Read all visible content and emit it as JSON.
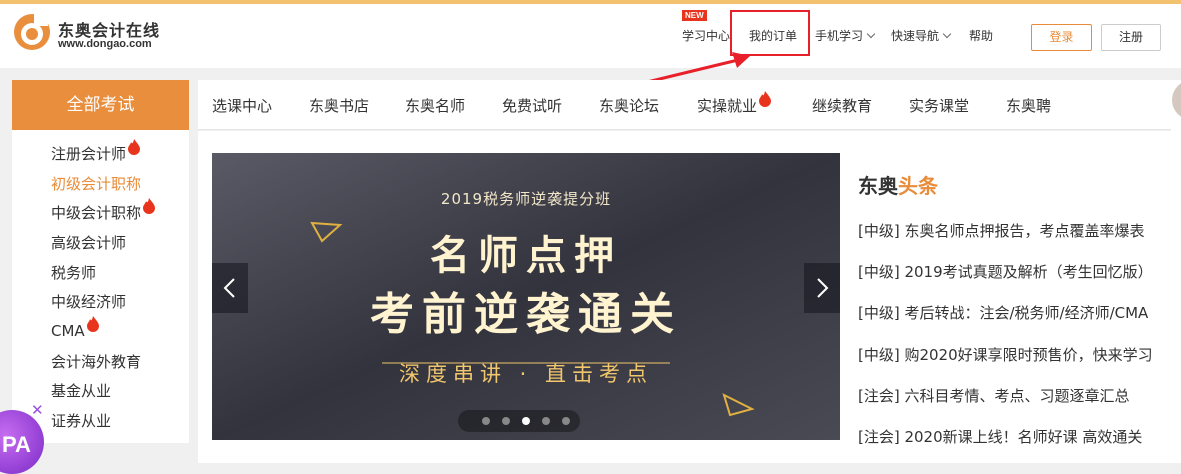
{
  "brand": {
    "name": "东奥会计在线",
    "url": "www.dongao.com"
  },
  "topnav": {
    "items": [
      {
        "label": "学习中心",
        "badge": "NEW"
      },
      {
        "label": "我的订单"
      },
      {
        "label": "手机学习",
        "has_dropdown": true
      },
      {
        "label": "快速导航",
        "has_dropdown": true
      },
      {
        "label": "帮助"
      }
    ],
    "login": "登录",
    "register": "注册"
  },
  "sidebar": {
    "header": "全部考试",
    "items": [
      {
        "label": "注册会计师",
        "hot": true
      },
      {
        "label": "初级会计职称",
        "active": true
      },
      {
        "label": "中级会计职称",
        "hot": true
      },
      {
        "label": "高级会计师"
      },
      {
        "label": "税务师"
      },
      {
        "label": "中级经济师"
      },
      {
        "label": "CMA",
        "hot": true
      },
      {
        "label": "会计海外教育"
      },
      {
        "label": "基金从业"
      },
      {
        "label": "证券从业"
      }
    ]
  },
  "mainnav": {
    "items": [
      {
        "label": "选课中心"
      },
      {
        "label": "东奥书店"
      },
      {
        "label": "东奥名师"
      },
      {
        "label": "免费试听"
      },
      {
        "label": "东奥论坛"
      },
      {
        "label": "实操就业",
        "hot": true
      },
      {
        "label": "继续教育"
      },
      {
        "label": "实务课堂"
      },
      {
        "label": "东奥聘"
      }
    ]
  },
  "banner": {
    "subtitle": "2019税务师逆袭提分班",
    "line1": "名师点押",
    "line2": "考前逆袭通关",
    "line3": "深度串讲 · 直击考点",
    "slide_count": 5,
    "active_slide": 3
  },
  "news": {
    "title_part1": "东奥",
    "title_part2": "头条",
    "items": [
      "[中级] 东奥名师点押报告，考点覆盖率爆表",
      "[中级] 2019考试真题及解析（考生回忆版）",
      "[中级] 考后转战：注会/税务师/经济师/CMA",
      "[中级] 购2020好课享限时预售价，快来学习",
      "[注会] 六科目考情、考点、习题逐章汇总",
      "[注会] 2020新课上线！名师好课 高效通关"
    ]
  },
  "floating": {
    "label": "PA"
  },
  "colors": {
    "accent": "#e88c3a",
    "highlight": "#e8202a",
    "hot": "#e8341c"
  }
}
